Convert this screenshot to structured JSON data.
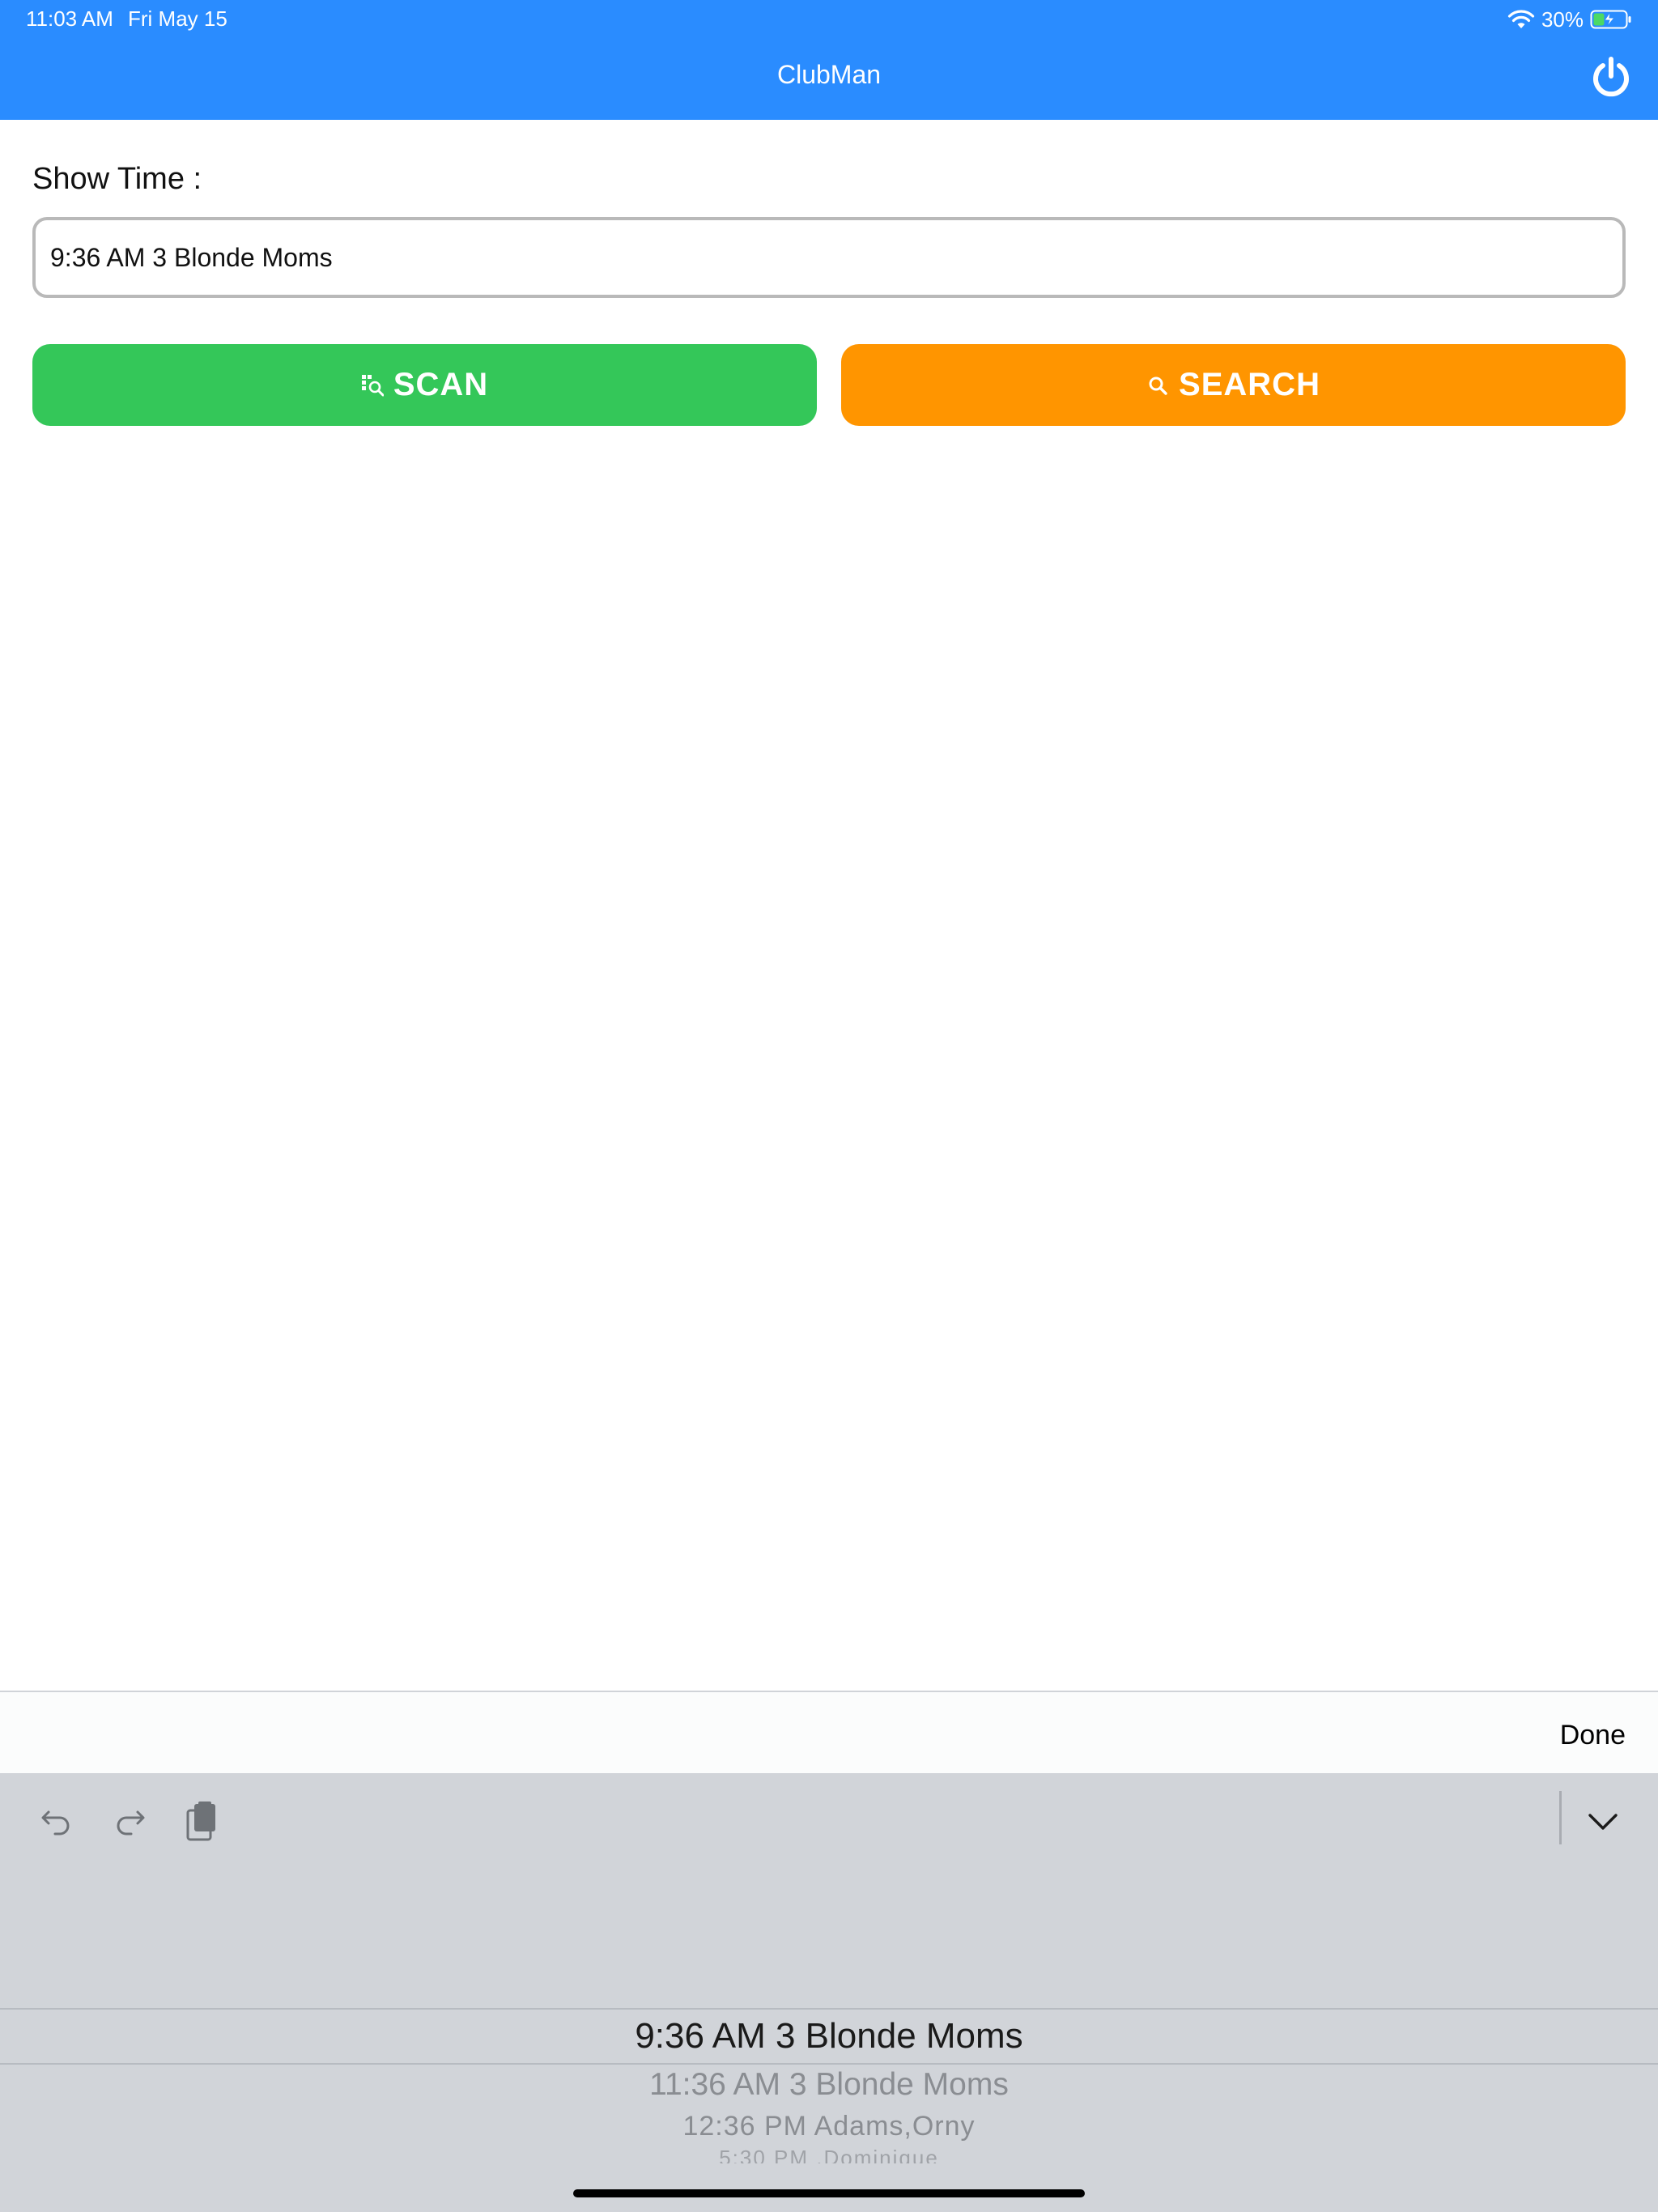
{
  "status_bar": {
    "time": "11:03 AM",
    "date": "Fri May 15",
    "battery": "30%"
  },
  "header": {
    "title": "ClubMan",
    "color": "#2a8cff",
    "power_icon": "power-icon"
  },
  "form": {
    "show_time_label": "Show Time :",
    "show_time_value": "9:36 AM 3 Blonde Moms"
  },
  "buttons": {
    "scan": {
      "label": "SCAN",
      "icon": "scan-icon",
      "color": "#34c759"
    },
    "search": {
      "label": "SEARCH",
      "icon": "search-icon",
      "color": "#ff9500"
    }
  },
  "accessory": {
    "done_label": "Done"
  },
  "keyboard": {
    "icons": [
      "undo-icon",
      "redo-icon",
      "paste-icon",
      "chevron-down-icon"
    ]
  },
  "picker": {
    "options": [
      "9:36 AM 3 Blonde Moms",
      "11:36 AM 3 Blonde Moms",
      "12:36 PM Adams,Orny",
      "5:30 PM ,Dominique"
    ],
    "selected_index": 0
  }
}
